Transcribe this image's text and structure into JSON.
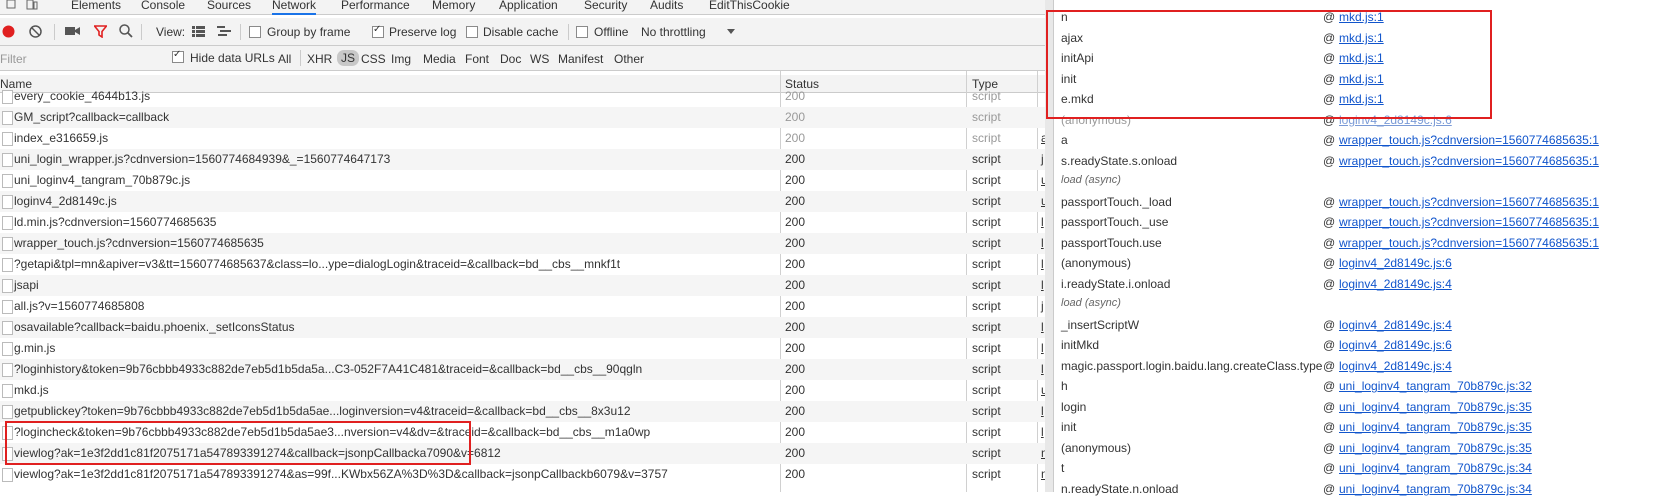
{
  "tabs": [
    "Elements",
    "Console",
    "Sources",
    "Network",
    "Performance",
    "Memory",
    "Application",
    "Security",
    "Audits",
    "EditThisCookie"
  ],
  "active_tab": "Network",
  "toolbar": {
    "view_label": "View:",
    "group_by_frame": "Group by frame",
    "group_by_frame_checked": false,
    "preserve_log": "Preserve log",
    "preserve_log_checked": true,
    "disable_cache": "Disable cache",
    "disable_cache_checked": false,
    "offline": "Offline",
    "offline_checked": false,
    "throttling": "No throttling"
  },
  "filterbar": {
    "filter_placeholder": "Filter",
    "hide_data_urls": "Hide data URLs",
    "hide_data_urls_checked": true,
    "types": [
      "All",
      "XHR",
      "JS",
      "CSS",
      "Img",
      "Media",
      "Font",
      "Doc",
      "WS",
      "Manifest",
      "Other"
    ],
    "active_type": "JS"
  },
  "columns": {
    "name": "Name",
    "status": "Status",
    "type": "Type"
  },
  "requests": [
    {
      "name": "every_cookie_4644b13.js",
      "status": "200",
      "type": "script",
      "initiator": "",
      "dim": true
    },
    {
      "name": "GM_script?callback=callback",
      "status": "200",
      "type": "script",
      "initiator": "",
      "dim": true
    },
    {
      "name": "index_e316659.js",
      "status": "200",
      "type": "script",
      "initiator": "a",
      "dim": true
    },
    {
      "name": "uni_login_wrapper.js?cdnversion=1560774684939&_=1560774647173",
      "status": "200",
      "type": "script",
      "initiator": "j",
      "dim": false
    },
    {
      "name": "uni_loginv4_tangram_70b879c.js",
      "status": "200",
      "type": "script",
      "initiator": "u",
      "dim": false
    },
    {
      "name": "loginv4_2d8149c.js",
      "status": "200",
      "type": "script",
      "initiator": "u",
      "dim": false
    },
    {
      "name": "ld.min.js?cdnversion=1560774685635",
      "status": "200",
      "type": "script",
      "initiator": "l",
      "dim": false
    },
    {
      "name": "wrapper_touch.js?cdnversion=1560774685635",
      "status": "200",
      "type": "script",
      "initiator": "l",
      "dim": false
    },
    {
      "name": "?getapi&tpl=mn&apiver=v3&tt=1560774685637&class=lo...ype=dialogLogin&traceid=&callback=bd__cbs__mnkf1t",
      "status": "200",
      "type": "script",
      "initiator": "l",
      "dim": false
    },
    {
      "name": "jsapi",
      "status": "200",
      "type": "script",
      "initiator": "l",
      "dim": false
    },
    {
      "name": "all.js?v=1560774685808",
      "status": "200",
      "type": "script",
      "initiator": "j",
      "dim": false
    },
    {
      "name": "osavailable?callback=baidu.phoenix._setIconsStatus",
      "status": "200",
      "type": "script",
      "initiator": "l",
      "dim": false
    },
    {
      "name": "g.min.js",
      "status": "200",
      "type": "script",
      "initiator": "l",
      "dim": false
    },
    {
      "name": "?loginhistory&token=9b76cbbb4933c882de7eb5d1b5da5a...C3-052F7A41C481&traceid=&callback=bd__cbs__90qgln",
      "status": "200",
      "type": "script",
      "initiator": "l",
      "dim": false
    },
    {
      "name": "mkd.js",
      "status": "200",
      "type": "script",
      "initiator": "u",
      "dim": false
    },
    {
      "name": "getpublickey?token=9b76cbbb4933c882de7eb5d1b5da5ae...loginversion=v4&traceid=&callback=bd__cbs__8x3u12",
      "status": "200",
      "type": "script",
      "initiator": "l",
      "dim": false
    },
    {
      "name": "?logincheck&token=9b76cbbb4933c882de7eb5d1b5da5ae3...nversion=v4&dv=&traceid=&callback=bd__cbs__m1a0wp",
      "status": "200",
      "type": "script",
      "initiator": "l",
      "dim": false
    },
    {
      "name": "viewlog?ak=1e3f2dd1c81f2075171a547893391274&callback=jsonpCallbacka7090&v=6812",
      "status": "200",
      "type": "script",
      "initiator": "n",
      "dim": false
    },
    {
      "name": "viewlog?ak=1e3f2dd1c81f2075171a547893391274&as=99f...KWbx56ZA%3D%3D&callback=jsonpCallbackb6079&v=3757",
      "status": "200",
      "type": "script",
      "initiator": "n",
      "dim": false
    }
  ],
  "callstack": [
    {
      "fn": "n",
      "link": "mkd.js:1",
      "kind": "frame"
    },
    {
      "fn": "ajax",
      "link": "mkd.js:1",
      "kind": "frame"
    },
    {
      "fn": "initApi",
      "link": "mkd.js:1",
      "kind": "frame"
    },
    {
      "fn": "init",
      "link": "mkd.js:1",
      "kind": "frame"
    },
    {
      "fn": "e.mkd",
      "link": "mkd.js:1",
      "kind": "frame"
    },
    {
      "fn": "(anonymous)",
      "link": "loginv4_2d8149c.js:6",
      "kind": "frame",
      "dim": true
    },
    {
      "fn": "a",
      "link": "wrapper_touch.js?cdnversion=1560774685635:1",
      "kind": "frame"
    },
    {
      "fn": "s.readyState.s.onload",
      "link": "wrapper_touch.js?cdnversion=1560774685635:1",
      "kind": "frame"
    },
    {
      "fn": "load (async)",
      "link": "",
      "kind": "async"
    },
    {
      "fn": "passportTouch._load",
      "link": "wrapper_touch.js?cdnversion=1560774685635:1",
      "kind": "frame"
    },
    {
      "fn": "passportTouch._use",
      "link": "wrapper_touch.js?cdnversion=1560774685635:1",
      "kind": "frame"
    },
    {
      "fn": "passportTouch.use",
      "link": "wrapper_touch.js?cdnversion=1560774685635:1",
      "kind": "frame"
    },
    {
      "fn": "(anonymous)",
      "link": "loginv4_2d8149c.js:6",
      "kind": "frame"
    },
    {
      "fn": "i.readyState.i.onload",
      "link": "loginv4_2d8149c.js:4",
      "kind": "frame"
    },
    {
      "fn": "load (async)",
      "link": "",
      "kind": "async"
    },
    {
      "fn": "_insertScriptW",
      "link": "loginv4_2d8149c.js:4",
      "kind": "frame"
    },
    {
      "fn": "initMkd",
      "link": "loginv4_2d8149c.js:6",
      "kind": "frame"
    },
    {
      "fn": "magic.passport.login.baidu.lang.createClass.type",
      "link": "loginv4_2d8149c.js:4",
      "kind": "frame"
    },
    {
      "fn": "h",
      "link": "uni_loginv4_tangram_70b879c.js:32",
      "kind": "frame"
    },
    {
      "fn": "login",
      "link": "uni_loginv4_tangram_70b879c.js:35",
      "kind": "frame"
    },
    {
      "fn": "init",
      "link": "uni_loginv4_tangram_70b879c.js:35",
      "kind": "frame"
    },
    {
      "fn": "(anonymous)",
      "link": "uni_loginv4_tangram_70b879c.js:35",
      "kind": "frame"
    },
    {
      "fn": "t",
      "link": "uni_loginv4_tangram_70b879c.js:34",
      "kind": "frame"
    },
    {
      "fn": "n.readyState.n.onload",
      "link": "uni_loginv4_tangram_70b879c.js:34",
      "kind": "frame"
    }
  ],
  "colors": {
    "highlight": "#e02020",
    "link": "#1155cc",
    "active_tab": "#1a73e8"
  }
}
